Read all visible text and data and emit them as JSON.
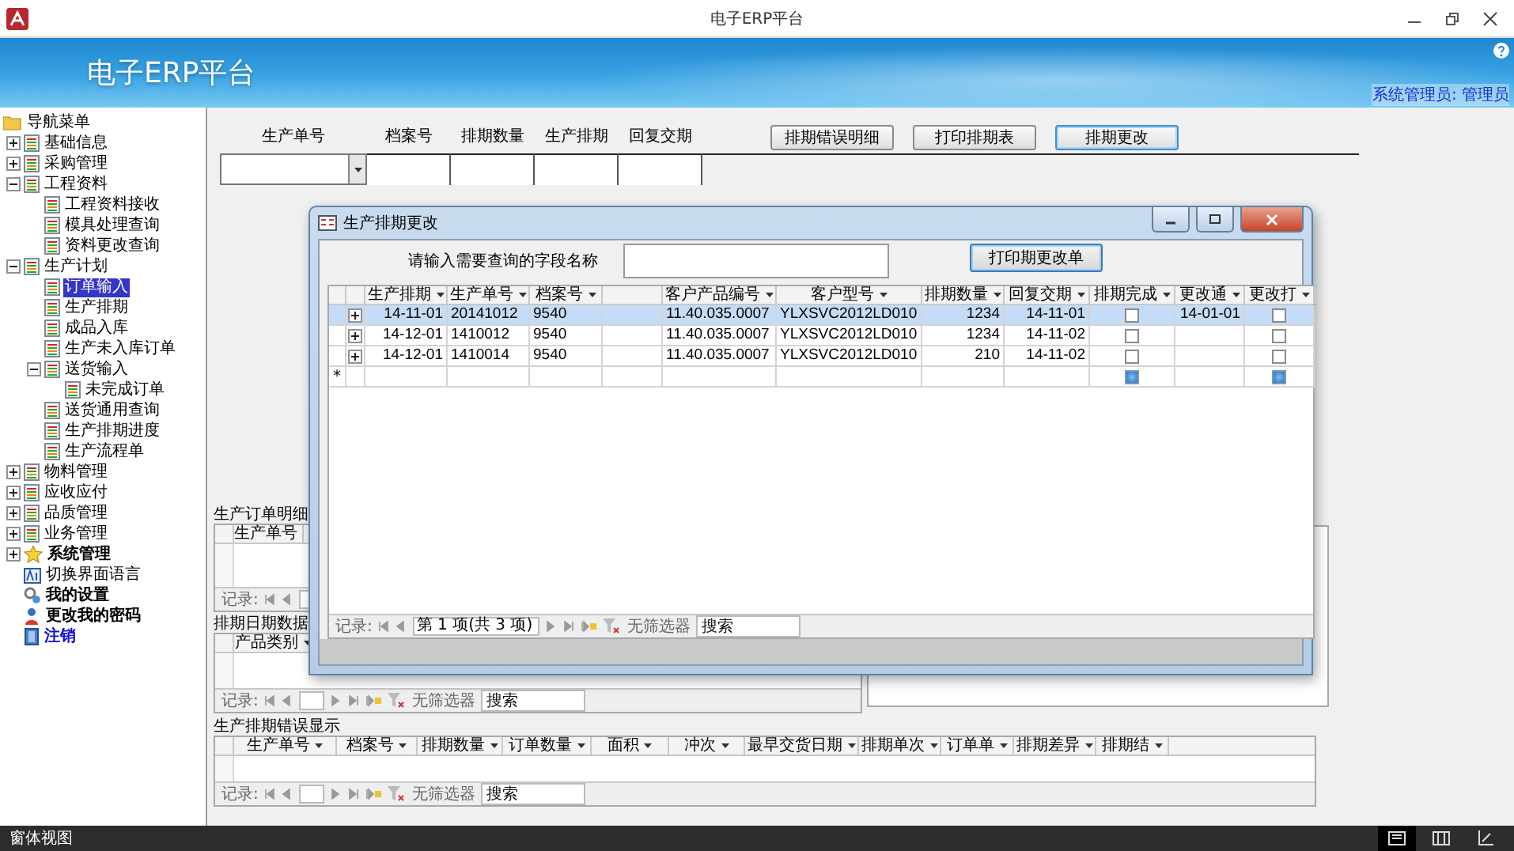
{
  "window": {
    "title": "电子ERP平台"
  },
  "banner": {
    "title": "电子ERP平台",
    "user": "系统管理员: 管理员"
  },
  "sidebar": {
    "root": {
      "label": "导航菜单",
      "kind": "folder",
      "selected": false,
      "children": [
        {
          "label": "基础信息",
          "kind": "doc",
          "selected": false,
          "expanded": false
        },
        {
          "label": "采购管理",
          "kind": "doc",
          "selected": false,
          "expanded": false
        },
        {
          "label": "工程资料",
          "kind": "doc",
          "selected": false,
          "expanded": true,
          "children": [
            {
              "label": "工程资料接收",
              "kind": "doc",
              "selected": false
            },
            {
              "label": "模具处理查询",
              "kind": "doc",
              "selected": false
            },
            {
              "label": "资料更改查询",
              "kind": "doc",
              "selected": false
            }
          ]
        },
        {
          "label": "生产计划",
          "kind": "doc",
          "selected": false,
          "expanded": true,
          "children": [
            {
              "label": "订单输入",
              "kind": "doc",
              "selected": true
            },
            {
              "label": "生产排期",
              "kind": "doc",
              "selected": false
            },
            {
              "label": "成品入库",
              "kind": "doc",
              "selected": false
            },
            {
              "label": "生产未入库订单",
              "kind": "doc",
              "selected": false
            },
            {
              "label": "送货输入",
              "kind": "doc",
              "selected": false,
              "expanded": true,
              "children": [
                {
                  "label": "未完成订单",
                  "kind": "doc",
                  "selected": false
                }
              ]
            },
            {
              "label": "送货通用查询",
              "kind": "doc",
              "selected": false
            },
            {
              "label": "生产排期进度",
              "kind": "doc",
              "selected": false
            },
            {
              "label": "生产流程单",
              "kind": "doc",
              "selected": false
            }
          ]
        },
        {
          "label": "物料管理",
          "kind": "doc",
          "selected": false,
          "expanded": false
        },
        {
          "label": "应收应付",
          "kind": "doc",
          "selected": false,
          "expanded": false
        },
        {
          "label": "品质管理",
          "kind": "doc",
          "selected": false,
          "expanded": false
        },
        {
          "label": "业务管理",
          "kind": "doc",
          "selected": false,
          "expanded": false
        },
        {
          "label": "系统管理",
          "kind": "star",
          "selected": false,
          "expanded": false
        },
        {
          "label": "切换界面语言",
          "kind": "lang",
          "selected": false
        },
        {
          "label": "我的设置",
          "kind": "settings",
          "selected": false
        },
        {
          "label": "更改我的密码",
          "kind": "password",
          "selected": false
        },
        {
          "label": "注销",
          "kind": "logout",
          "selected": false
        }
      ]
    }
  },
  "form": {
    "fields": [
      {
        "label": "生产单号",
        "kind": "combo"
      },
      {
        "label": "档案号",
        "kind": "text"
      },
      {
        "label": "排期数量",
        "kind": "text"
      },
      {
        "label": "生产排期",
        "kind": "text"
      },
      {
        "label": "回复交期",
        "kind": "text"
      }
    ],
    "buttons": [
      {
        "label": "排期错误明细",
        "default": false
      },
      {
        "label": "打印排期表",
        "default": false
      },
      {
        "label": "排期更改",
        "default": true
      }
    ]
  },
  "subforms": [
    {
      "title": "生产订单明细",
      "columns": [
        "生产单号"
      ],
      "nav": {
        "record_label": "记录:"
      }
    },
    {
      "title": "排期日期数据",
      "columns": [
        "产品类别"
      ],
      "nav": {
        "record_label": "记录:",
        "filter": "无筛选器",
        "search_placeholder": "搜索"
      }
    }
  ],
  "error_table": {
    "title": "生产排期错误显示",
    "columns": [
      "生产单号",
      "档案号",
      "排期数量",
      "订单数量",
      "面积",
      "冲次",
      "最早交货日期",
      "排期单次",
      "订单单",
      "排期差异",
      "排期结"
    ],
    "nav": {
      "record_label": "记录:",
      "filter": "无筛选器",
      "search_placeholder": "搜索"
    }
  },
  "dialog": {
    "title": "生产排期更改",
    "search_label": "请输入需要查询的字段名称",
    "print_button": "打印期更改单",
    "columns": [
      {
        "label": "生产排期",
        "kind": "date"
      },
      {
        "label": "生产单号",
        "kind": "text"
      },
      {
        "label": "档案号",
        "kind": "text"
      },
      {
        "kind": "blurred"
      },
      {
        "label": "客户产品编号",
        "kind": "text"
      },
      {
        "label": "客户型号",
        "kind": "text"
      },
      {
        "label": "排期数量",
        "kind": "number"
      },
      {
        "label": "回复交期",
        "kind": "date"
      },
      {
        "label": "排期完成",
        "kind": "check"
      },
      {
        "label": "更改通",
        "kind": "date"
      },
      {
        "label": "更改打",
        "kind": "check"
      }
    ],
    "rows": [
      {
        "selected": true,
        "cells": [
          "14-11-01",
          "20141012",
          "9540",
          null,
          "11.40.035.0007",
          "YLXSVC2012LD010",
          "1234",
          "14-11-01",
          false,
          "14-01-01",
          false
        ]
      },
      {
        "selected": false,
        "cells": [
          "14-12-01",
          "1410012",
          "9540",
          null,
          "11.40.035.0007",
          "YLXSVC2012LD010",
          "1234",
          "14-11-02",
          false,
          null,
          false
        ]
      },
      {
        "selected": false,
        "cells": [
          "14-12-01",
          "1410014",
          "9540",
          null,
          "11.40.035.0007",
          "YLXSVC2012LD010",
          "210",
          "14-11-02",
          false,
          null,
          false
        ]
      }
    ],
    "new_row": {
      "marker": "*",
      "default_checked": true
    },
    "nav": {
      "record_label": "记录:",
      "position": "第 1 项(共 3 项)",
      "filter": "无筛选器",
      "search_placeholder": "搜索"
    }
  },
  "status_bar": {
    "text": "窗体视图",
    "views": [
      {
        "kind": "form",
        "selected": true
      },
      {
        "kind": "datasheet",
        "selected": false
      },
      {
        "kind": "layout",
        "selected": false
      }
    ]
  }
}
